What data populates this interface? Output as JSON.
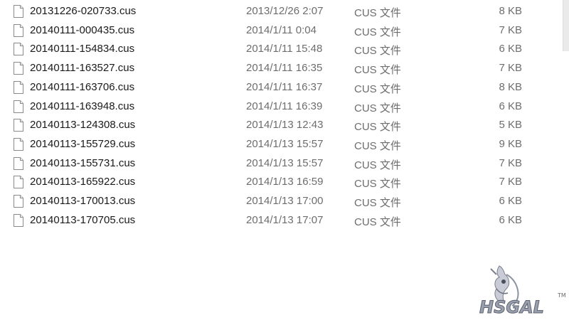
{
  "files": [
    {
      "name": "20131226-020733.cus",
      "date": "2013/12/26 2:07",
      "type": "CUS 文件",
      "size": "8 KB"
    },
    {
      "name": "20140111-000435.cus",
      "date": "2014/1/11 0:04",
      "type": "CUS 文件",
      "size": "7 KB"
    },
    {
      "name": "20140111-154834.cus",
      "date": "2014/1/11 15:48",
      "type": "CUS 文件",
      "size": "6 KB"
    },
    {
      "name": "20140111-163527.cus",
      "date": "2014/1/11 16:35",
      "type": "CUS 文件",
      "size": "7 KB"
    },
    {
      "name": "20140111-163706.cus",
      "date": "2014/1/11 16:37",
      "type": "CUS 文件",
      "size": "8 KB"
    },
    {
      "name": "20140111-163948.cus",
      "date": "2014/1/11 16:39",
      "type": "CUS 文件",
      "size": "6 KB"
    },
    {
      "name": "20140113-124308.cus",
      "date": "2014/1/13 12:43",
      "type": "CUS 文件",
      "size": "5 KB"
    },
    {
      "name": "20140113-155729.cus",
      "date": "2014/1/13 15:57",
      "type": "CUS 文件",
      "size": "9 KB"
    },
    {
      "name": "20140113-155731.cus",
      "date": "2014/1/13 15:57",
      "type": "CUS 文件",
      "size": "7 KB"
    },
    {
      "name": "20140113-165922.cus",
      "date": "2014/1/13 16:59",
      "type": "CUS 文件",
      "size": "7 KB"
    },
    {
      "name": "20140113-170013.cus",
      "date": "2014/1/13 17:00",
      "type": "CUS 文件",
      "size": "6 KB"
    },
    {
      "name": "20140113-170705.cus",
      "date": "2014/1/13 17:07",
      "type": "CUS 文件",
      "size": "6 KB"
    }
  ],
  "icons": {
    "file": "generic-file-icon"
  },
  "watermark": {
    "text": "HSGAL",
    "mark": "TM"
  },
  "colors": {
    "name_text": "#1a1a1a",
    "meta_text": "#6d6d6d",
    "watermark_fill": "#9aa0ad"
  }
}
